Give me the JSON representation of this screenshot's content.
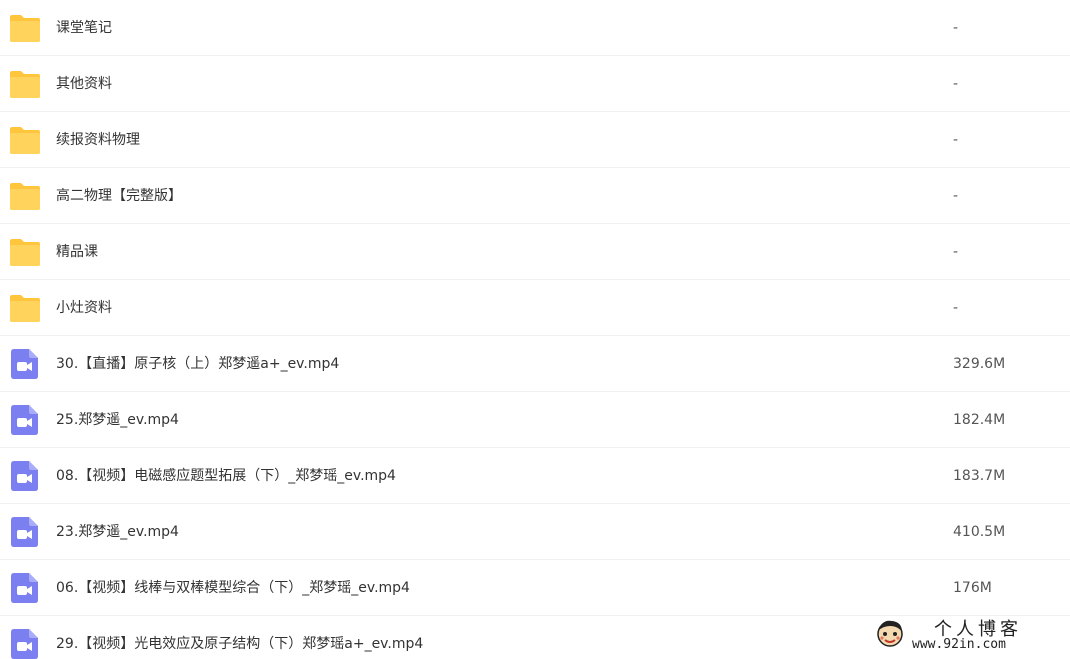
{
  "files": [
    {
      "type": "folder",
      "icon": "folder-icon",
      "name": "课堂笔记",
      "size": "-"
    },
    {
      "type": "folder",
      "icon": "folder-icon",
      "name": "其他资料",
      "size": "-"
    },
    {
      "type": "folder",
      "icon": "folder-icon",
      "name": "续报资料物理",
      "size": "-"
    },
    {
      "type": "folder",
      "icon": "folder-icon",
      "name": "高二物理【完整版】",
      "size": "-"
    },
    {
      "type": "folder",
      "icon": "folder-icon",
      "name": "精品课",
      "size": "-"
    },
    {
      "type": "folder",
      "icon": "folder-icon",
      "name": "小灶资料",
      "size": "-"
    },
    {
      "type": "video",
      "icon": "video-file-icon",
      "name": "30.【直播】原子核（上）郑梦遥a+_ev.mp4",
      "size": "329.6M"
    },
    {
      "type": "video",
      "icon": "video-file-icon",
      "name": "25.郑梦遥_ev.mp4",
      "size": "182.4M"
    },
    {
      "type": "video",
      "icon": "video-file-icon",
      "name": "08.【视频】电磁感应题型拓展（下）_郑梦瑶_ev.mp4",
      "size": "183.7M"
    },
    {
      "type": "video",
      "icon": "video-file-icon",
      "name": "23.郑梦遥_ev.mp4",
      "size": "410.5M"
    },
    {
      "type": "video",
      "icon": "video-file-icon",
      "name": "06.【视频】线棒与双棒模型综合（下）_郑梦瑶_ev.mp4",
      "size": "176M"
    },
    {
      "type": "video",
      "icon": "video-file-icon",
      "name": "29.【视频】光电效应及原子结构（下）郑梦瑶a+_ev.mp4",
      "size": ""
    }
  ],
  "watermark": {
    "title": "个人博客",
    "url": "www.92in.com"
  },
  "colors": {
    "folder": "#FFD35C",
    "folder_tab": "#FFC53D",
    "video": "#7B7FF0",
    "divider": "#F0F0F0"
  }
}
